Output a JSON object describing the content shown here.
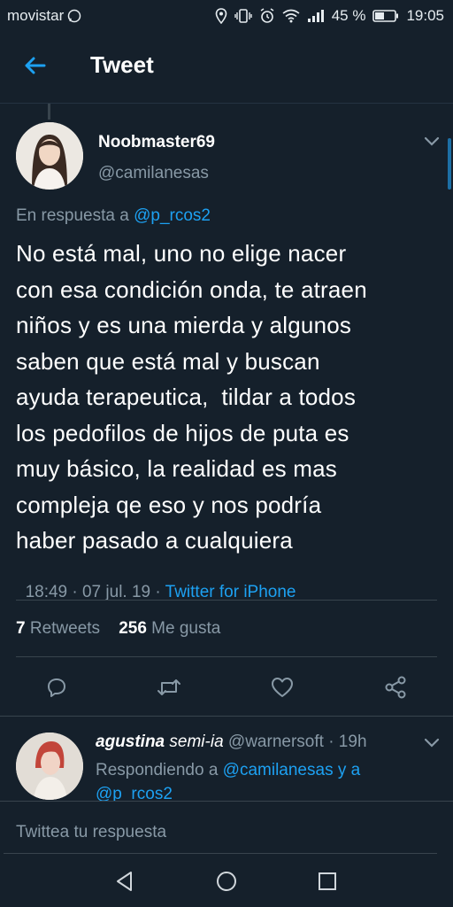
{
  "status_bar": {
    "carrier": "movistar",
    "battery_percent": "45 %",
    "time": "19:05"
  },
  "header": {
    "title": "Tweet"
  },
  "tweet": {
    "display_name": "Noobmaster69",
    "handle": "@camilanesas",
    "reply_prefix": "En respuesta a",
    "reply_to": "@p_rcos2",
    "text_lines": [
      "No está mal, uno no elige nacer",
      "con esa condición onda, te atraen",
      "niños y es una mierda y algunos",
      "saben que está mal y buscan",
      "ayuda terapeutica,  tildar a todos",
      "los pedofilos de hijos de puta es",
      "muy básico, la realidad es mas",
      "compleja qe eso y nos podría",
      "haber pasado a cualquiera"
    ],
    "timestamp": "18:49 · 07 jul. 19 · ",
    "source": "Twitter for iPhone",
    "retweets_count": "7",
    "retweets_label": "Retweets",
    "likes_count": "256",
    "likes_label": "Me gusta"
  },
  "reply": {
    "display_name": "agustina",
    "name_suffix": "semi-ia",
    "handle": "@warnersoft",
    "time": "· 19h",
    "replying_prefix": "Respondiendo a",
    "replying_to_1": "@camilanesas y a",
    "replying_to_2": "@p_rcos2"
  },
  "composer": {
    "placeholder": "Twittea tu respuesta"
  },
  "colors": {
    "background": "#15202b",
    "accent": "#1da1f2",
    "muted": "#8899a6",
    "divider": "#38444d"
  },
  "icons": [
    "back-arrow-icon",
    "chevron-down-icon",
    "reply-icon",
    "retweet-icon",
    "like-icon",
    "share-icon",
    "nav-back-icon",
    "nav-home-icon",
    "nav-recents-icon"
  ]
}
